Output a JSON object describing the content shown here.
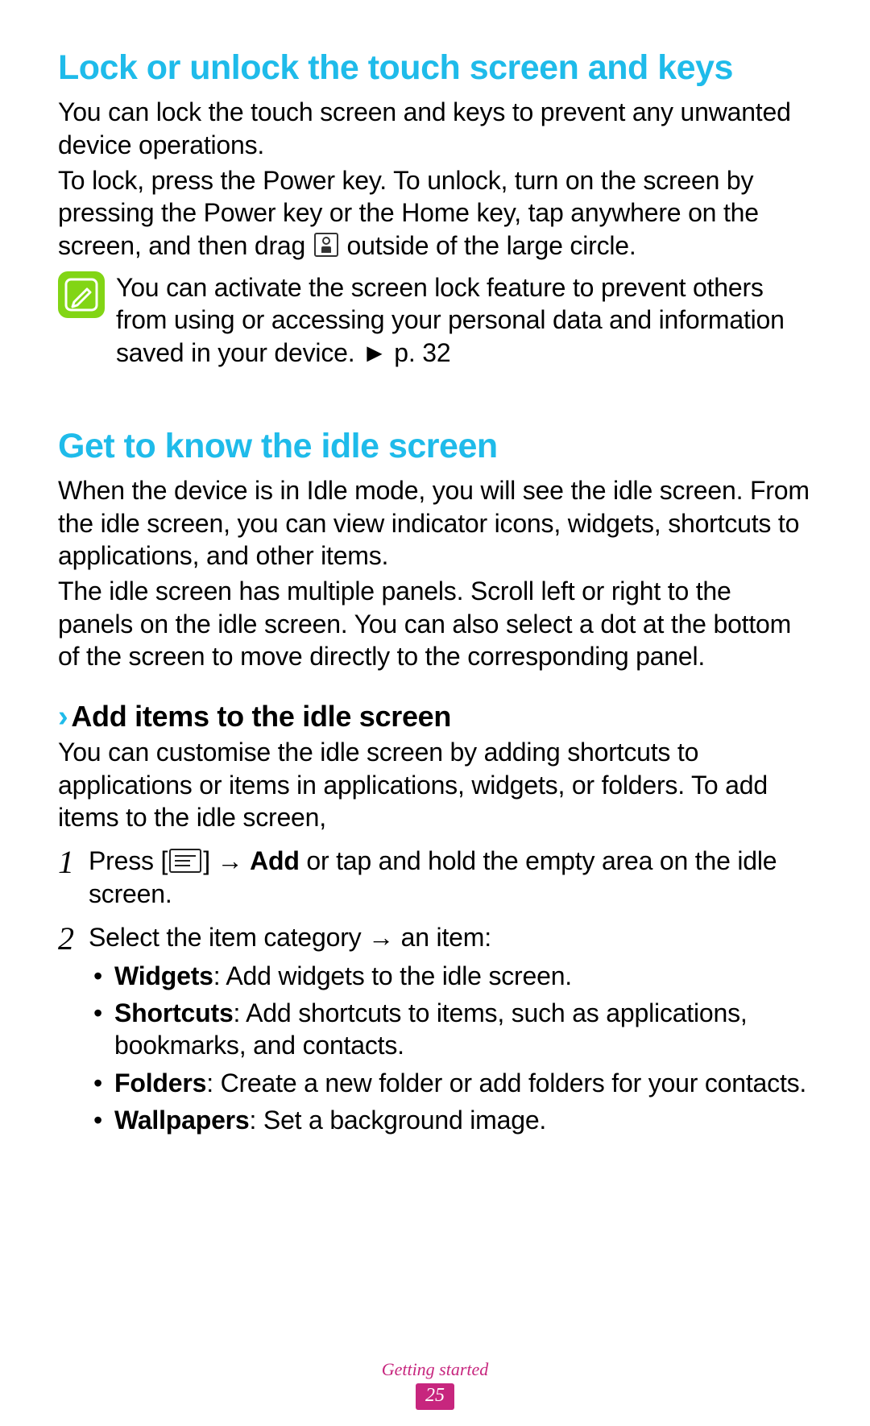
{
  "section1": {
    "title": "Lock or unlock the touch screen and keys",
    "para1": "You can lock the touch screen and keys to prevent any unwanted device operations.",
    "para2_a": "To lock, press the Power key. To unlock, turn on the screen by pressing the Power key or the Home key, tap anywhere on the screen, and then drag ",
    "para2_b": " outside of the large circle.",
    "note_a": "You can activate the screen lock feature to prevent others from using or accessing your personal data and information saved in your device. ",
    "note_ref": "► p. 32"
  },
  "section2": {
    "title": "Get to know the idle screen",
    "para1": "When the device is in Idle mode, you will see the idle screen. From the idle screen, you can view indicator icons, widgets, shortcuts to applications, and other items.",
    "para2": "The idle screen has multiple panels. Scroll left or right to the panels on the idle screen. You can also select a dot at the bottom of the screen to move directly to the corresponding panel."
  },
  "sub": {
    "heading": "Add items to the idle screen",
    "intro": "You can customise the idle screen by adding shortcuts to applications or items in applications, widgets, or folders. To add items to the idle screen,",
    "step1_num": "1",
    "step1_a": "Press [",
    "step1_b": "] → ",
    "step1_bold": "Add",
    "step1_c": " or tap and hold the empty area on the idle screen.",
    "step2_num": "2",
    "step2": "Select the item category → an item:",
    "bullets": {
      "widgets_label": "Widgets",
      "widgets_text": ": Add widgets to the idle screen.",
      "shortcuts_label": "Shortcuts",
      "shortcuts_text": ": Add shortcuts to items, such as applications, bookmarks, and contacts.",
      "folders_label": "Folders",
      "folders_text": ": Create a new folder or add folders for your contacts.",
      "wallpapers_label": "Wallpapers",
      "wallpapers_text": ": Set a background image."
    }
  },
  "footer": {
    "section": "Getting started",
    "page": "25"
  }
}
